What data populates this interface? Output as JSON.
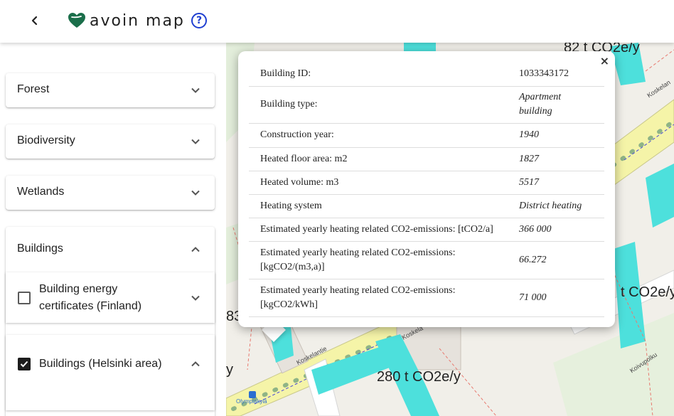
{
  "header": {
    "logo_text": "avoin map",
    "help_label": "?",
    "colors": {
      "logo_heart": "#1a6e4a",
      "help": "#1f3fd1"
    }
  },
  "sidebar": {
    "sections": [
      {
        "label": "Forest",
        "expanded": false
      },
      {
        "label": "Biodiversity",
        "expanded": false
      },
      {
        "label": "Wetlands",
        "expanded": false
      },
      {
        "label": "Buildings",
        "expanded": true
      }
    ],
    "layers": [
      {
        "label_line1": "Building energy",
        "label_line2": "certificates (Finland)",
        "checked": false,
        "expanded": false
      },
      {
        "label": "Buildings (Helsinki area)",
        "checked": true,
        "expanded": true
      }
    ]
  },
  "map": {
    "labels": {
      "top": "82 t CO2e/y",
      "right": "t CO2e/y",
      "bottom": "280 t CO2e/y",
      "left_fragment": "83",
      "left_fragment2": "y"
    },
    "streets": [
      "Koskelantie",
      "Koskelan",
      "Koskela",
      "Koivupolku"
    ],
    "stop_name": "Olympiakylä",
    "colors": {
      "buildings": "#4de0dc",
      "road": "#f5f4a8",
      "background": "#f1efe9"
    }
  },
  "popup": {
    "close_label": "×",
    "rows": [
      {
        "label": "Building ID:",
        "value": "1033343172"
      },
      {
        "label": "Building type:",
        "value_line1": "Apartment",
        "value_line2": "building"
      },
      {
        "label": "Construction year:",
        "value": "1940"
      },
      {
        "label": "Heated floor area: m2",
        "value": "1827"
      },
      {
        "label": "Heated volume: m3",
        "value": "5517"
      },
      {
        "label": "Heating system",
        "value": "District heating"
      },
      {
        "label": "Estimated yearly heating related CO2-emissions: [tCO2/a]",
        "value": "366 000"
      },
      {
        "label_line1": "Estimated yearly heating related CO2-emissions:",
        "label_line2": "[kgCO2/(m3,a)]",
        "value": "66.272"
      },
      {
        "label_line1": "Estimated yearly heating related CO2-emissions:",
        "label_line2": "[kgCO2/kWh]",
        "value": "71 000"
      }
    ]
  }
}
